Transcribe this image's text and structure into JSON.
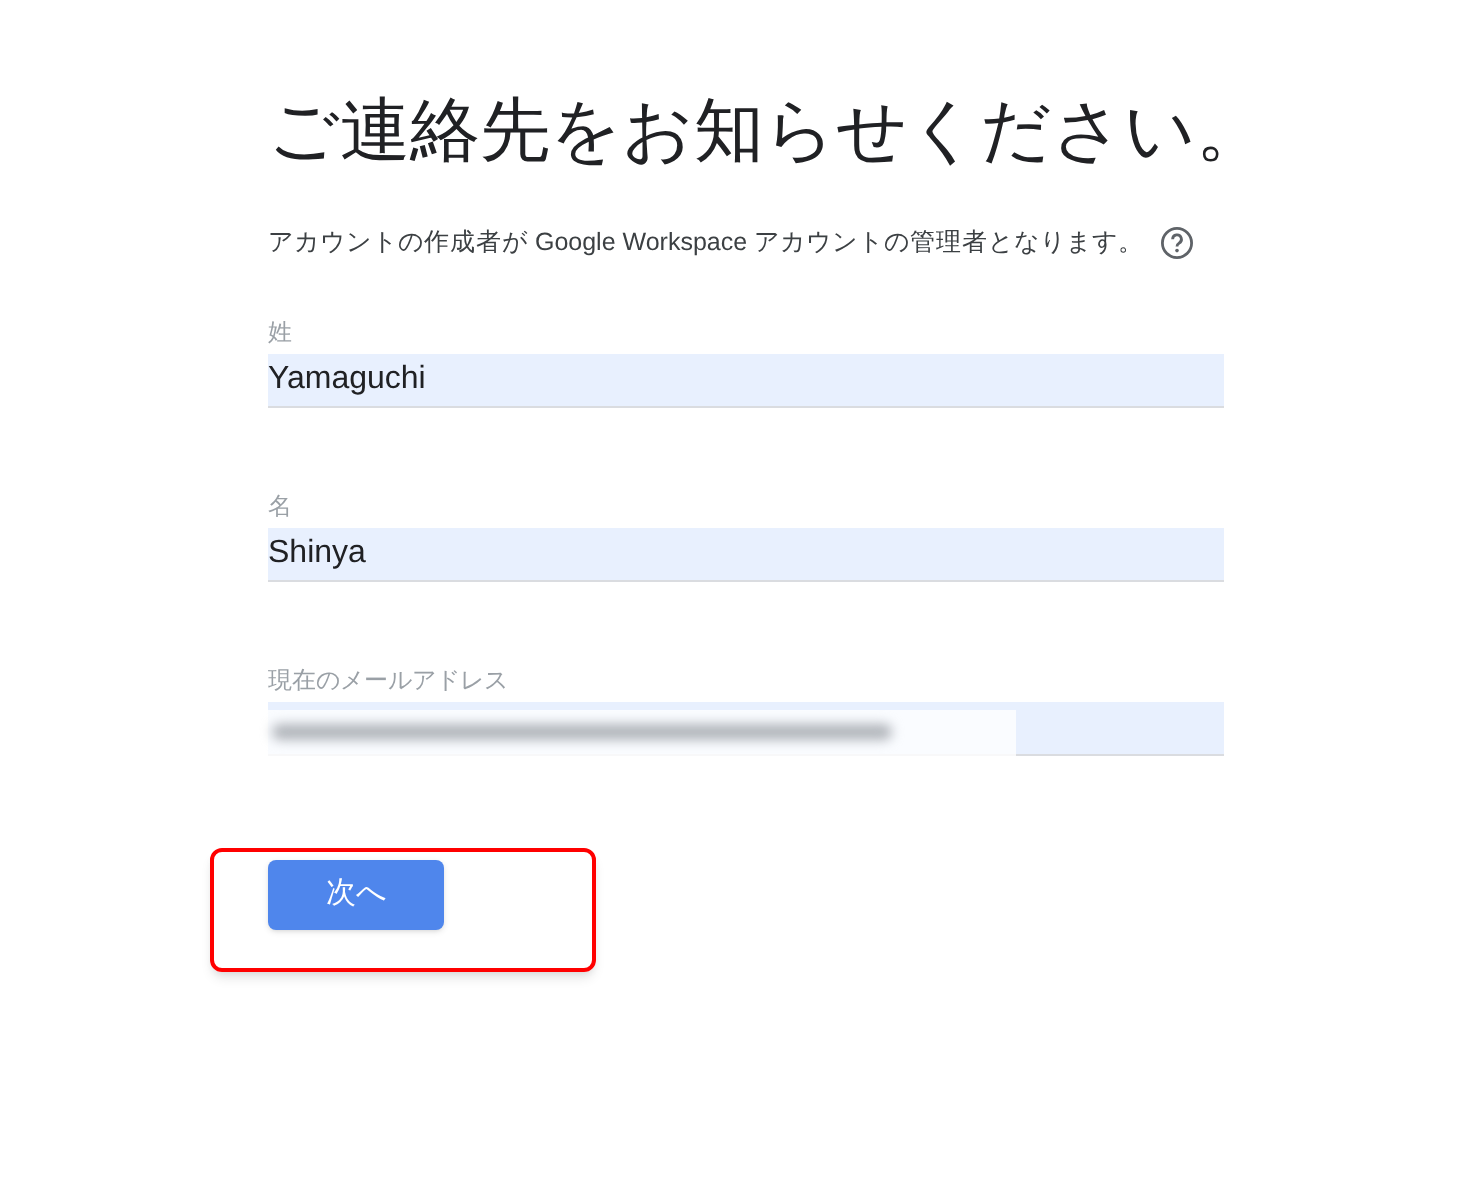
{
  "heading": "ご連絡先をお知らせください。",
  "description": "アカウントの作成者が Google Workspace アカウントの管理者となります。",
  "fields": [
    {
      "label": "姓",
      "value": "Yamaguchi"
    },
    {
      "label": "名",
      "value": "Shinya"
    },
    {
      "label": "現在のメールアドレス",
      "redacted": true
    }
  ],
  "next_button": {
    "label": "次へ",
    "highlighted": true
  }
}
